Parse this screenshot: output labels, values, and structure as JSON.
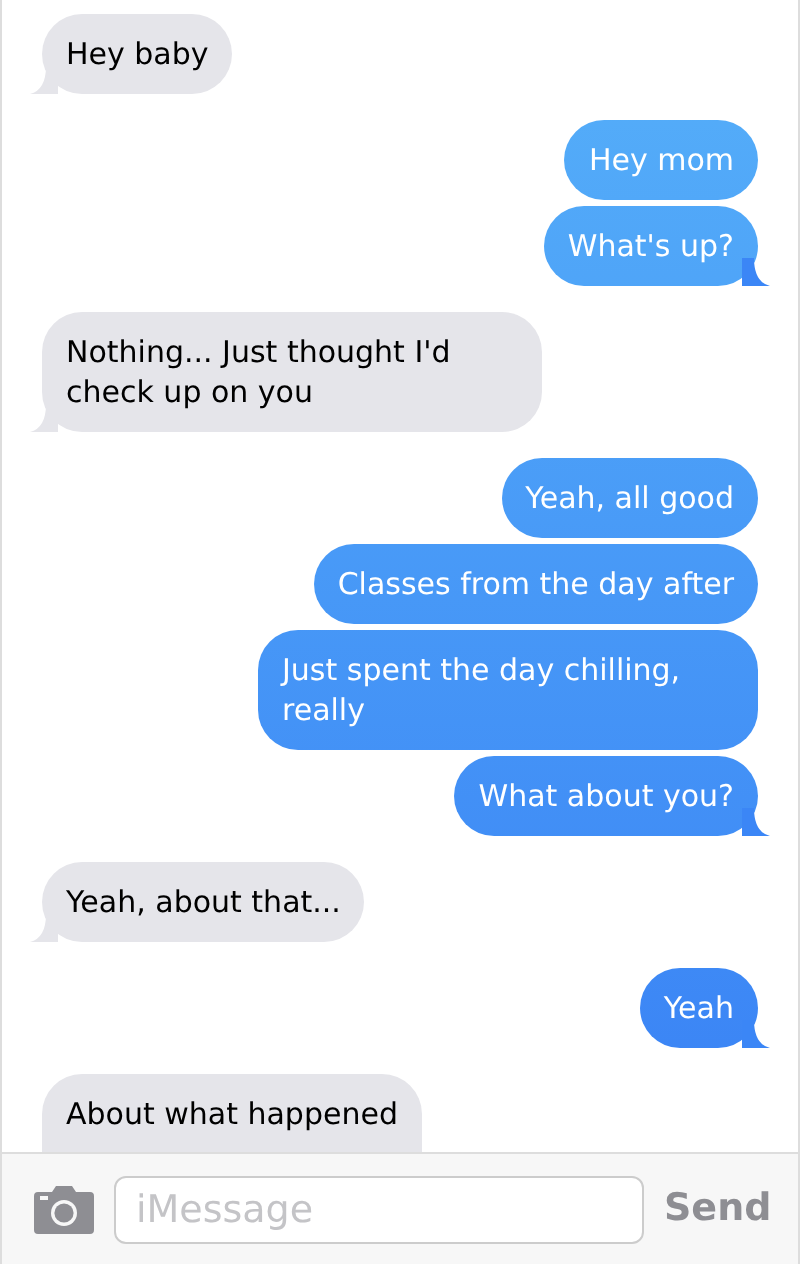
{
  "messages": [
    {
      "kind": "received",
      "text": "Hey baby",
      "tail": true
    },
    {
      "kind": "sent",
      "text": "Hey mom",
      "tail": false
    },
    {
      "kind": "sent",
      "text": "What's up?",
      "tail": true
    },
    {
      "kind": "received",
      "text": "Nothing... Just thought I'd check up on you",
      "tail": true
    },
    {
      "kind": "sent",
      "text": "Yeah, all good",
      "tail": false
    },
    {
      "kind": "sent",
      "text": "Classes from the day after",
      "tail": false
    },
    {
      "kind": "sent",
      "text": "Just spent the day chilling, really",
      "tail": false
    },
    {
      "kind": "sent",
      "text": "What about you?",
      "tail": true
    },
    {
      "kind": "received",
      "text": "Yeah, about that...",
      "tail": true
    },
    {
      "kind": "sent",
      "text": "Yeah",
      "tail": true
    },
    {
      "kind": "received",
      "text": "About what happened",
      "tail": false
    }
  ],
  "composer": {
    "placeholder": "iMessage",
    "send": "Send"
  }
}
